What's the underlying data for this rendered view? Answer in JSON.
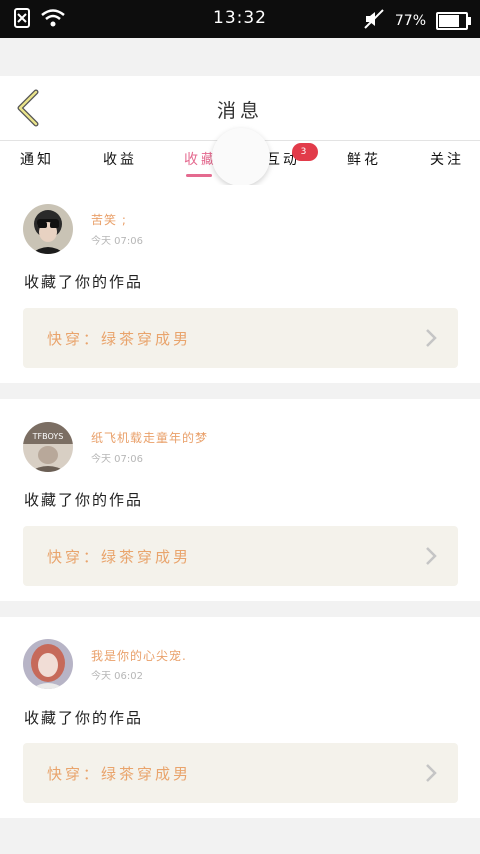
{
  "status_bar": {
    "time": "13:32",
    "battery": "77%",
    "battery_level": 0.77,
    "icons": [
      "sim-off-icon",
      "wifi-icon",
      "mute-icon",
      "battery-icon"
    ]
  },
  "header": {
    "title": "消息",
    "back_icon": "chevron-left-icon"
  },
  "tabs": [
    {
      "label": "通知"
    },
    {
      "label": "收益"
    },
    {
      "label": "收藏"
    },
    {
      "label": "互动",
      "badge": "3"
    },
    {
      "label": "鲜花"
    },
    {
      "label": "关注"
    }
  ],
  "active_tab": "收藏",
  "messages": [
    {
      "name": "苦笑 ;",
      "time": "今天 07:06",
      "action": "收藏了你的作品",
      "work": "快穿：绿茶穿成男"
    },
    {
      "name": "纸飞机载走童年的梦",
      "time": "今天 07:06",
      "action": "收藏了你的作品",
      "work": "快穿：绿茶穿成男"
    },
    {
      "name": "我是你的心尖宠.",
      "time": "今天 06:02",
      "action": "收藏了你的作品",
      "work": "快穿：绿茶穿成男"
    }
  ],
  "colors": {
    "accent": "#e46a8f",
    "name": "#e9a06a",
    "badge": "#e23b4a",
    "work_bg": "#f4f2eb"
  }
}
